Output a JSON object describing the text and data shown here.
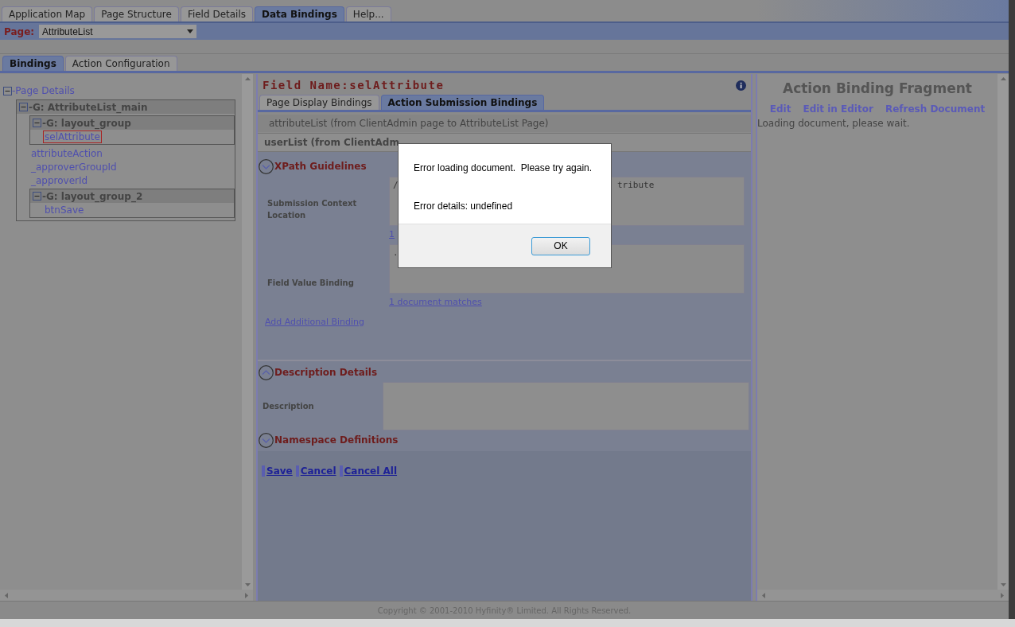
{
  "top_tabs": [
    {
      "label": "Application Map",
      "selected": false
    },
    {
      "label": "Page Structure",
      "selected": false
    },
    {
      "label": "Field Details",
      "selected": false
    },
    {
      "label": "Data Bindings",
      "selected": true
    },
    {
      "label": "Help...",
      "selected": false
    }
  ],
  "page_selector": {
    "label": "Page:",
    "value": "AttributeList"
  },
  "sub_tabs": [
    {
      "label": "Bindings",
      "selected": true
    },
    {
      "label": "Action Configuration",
      "selected": false
    }
  ],
  "tree": {
    "label": "-Page Details",
    "expanded": true,
    "children": [
      {
        "kind": "group",
        "label": "-G: AttributeList_main",
        "expanded": true,
        "children": [
          {
            "kind": "group",
            "label": "-G: layout_group",
            "expanded": true,
            "children": [
              {
                "kind": "field",
                "label": "selAttribute",
                "selected": true
              }
            ]
          },
          {
            "kind": "field",
            "label": "attributeAction",
            "selected": false
          },
          {
            "kind": "field",
            "label": "_approverGroupId",
            "selected": false
          },
          {
            "kind": "field",
            "label": "_approverId",
            "selected": false
          },
          {
            "kind": "group",
            "label": "-G: layout_group_2",
            "expanded": true,
            "children": [
              {
                "kind": "field",
                "label": "btnSave",
                "selected": false
              }
            ]
          }
        ]
      }
    ]
  },
  "field_title": "Field Name:selAttribute",
  "binding_tabs": [
    {
      "label": "Page Display Bindings",
      "selected": false
    },
    {
      "label": "Action Submission Bindings",
      "selected": true
    }
  ],
  "bindings": [
    {
      "kind": "row",
      "label": "attributeList (from ClientAdmin page to AttributeList Page)"
    },
    {
      "kind": "header",
      "label": "userList (from ClientAdm"
    }
  ],
  "sections": [
    {
      "title": "XPath Guidelines",
      "arrow_up": false
    },
    {
      "title": "Description Details",
      "arrow_up": true
    },
    {
      "title": "Namespace Definitions",
      "arrow_up": false
    }
  ],
  "xpath_fields": [
    {
      "label": "Submission Context Location",
      "value_start": "/",
      "value_end": "tribute",
      "link": "1"
    },
    {
      "label": "Field Value Binding",
      "value_start": ".",
      "link": "1 document matches"
    }
  ],
  "add_link": "Add Additional Binding",
  "description_label": "Description",
  "actions": [
    "Save",
    "Cancel",
    "Cancel All"
  ],
  "fragment": {
    "title": "Action Binding Fragment",
    "links": [
      "Edit",
      "Edit in Editor",
      "Refresh Document"
    ],
    "status": "Loading document, please wait."
  },
  "footer": "Copyright © 2001-2010 Hyfinity® Limited. All Rights Reserved.",
  "dialog": {
    "message": "Error loading document.  Please try again.",
    "details": "Error details: undefined",
    "button": "OK"
  }
}
